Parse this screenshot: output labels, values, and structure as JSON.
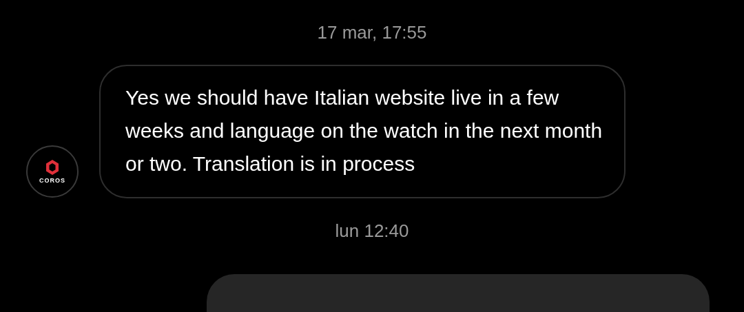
{
  "messages": [
    {
      "kind": "timestamp",
      "text": "17 mar, 17:55"
    },
    {
      "kind": "incoming",
      "avatar": "COROS",
      "text": "Yes we should have Italian website live in a few weeks and language on the watch in the next month or two. Translation is in process"
    },
    {
      "kind": "timestamp",
      "text": "lun 12:40"
    },
    {
      "kind": "outgoing"
    }
  ]
}
